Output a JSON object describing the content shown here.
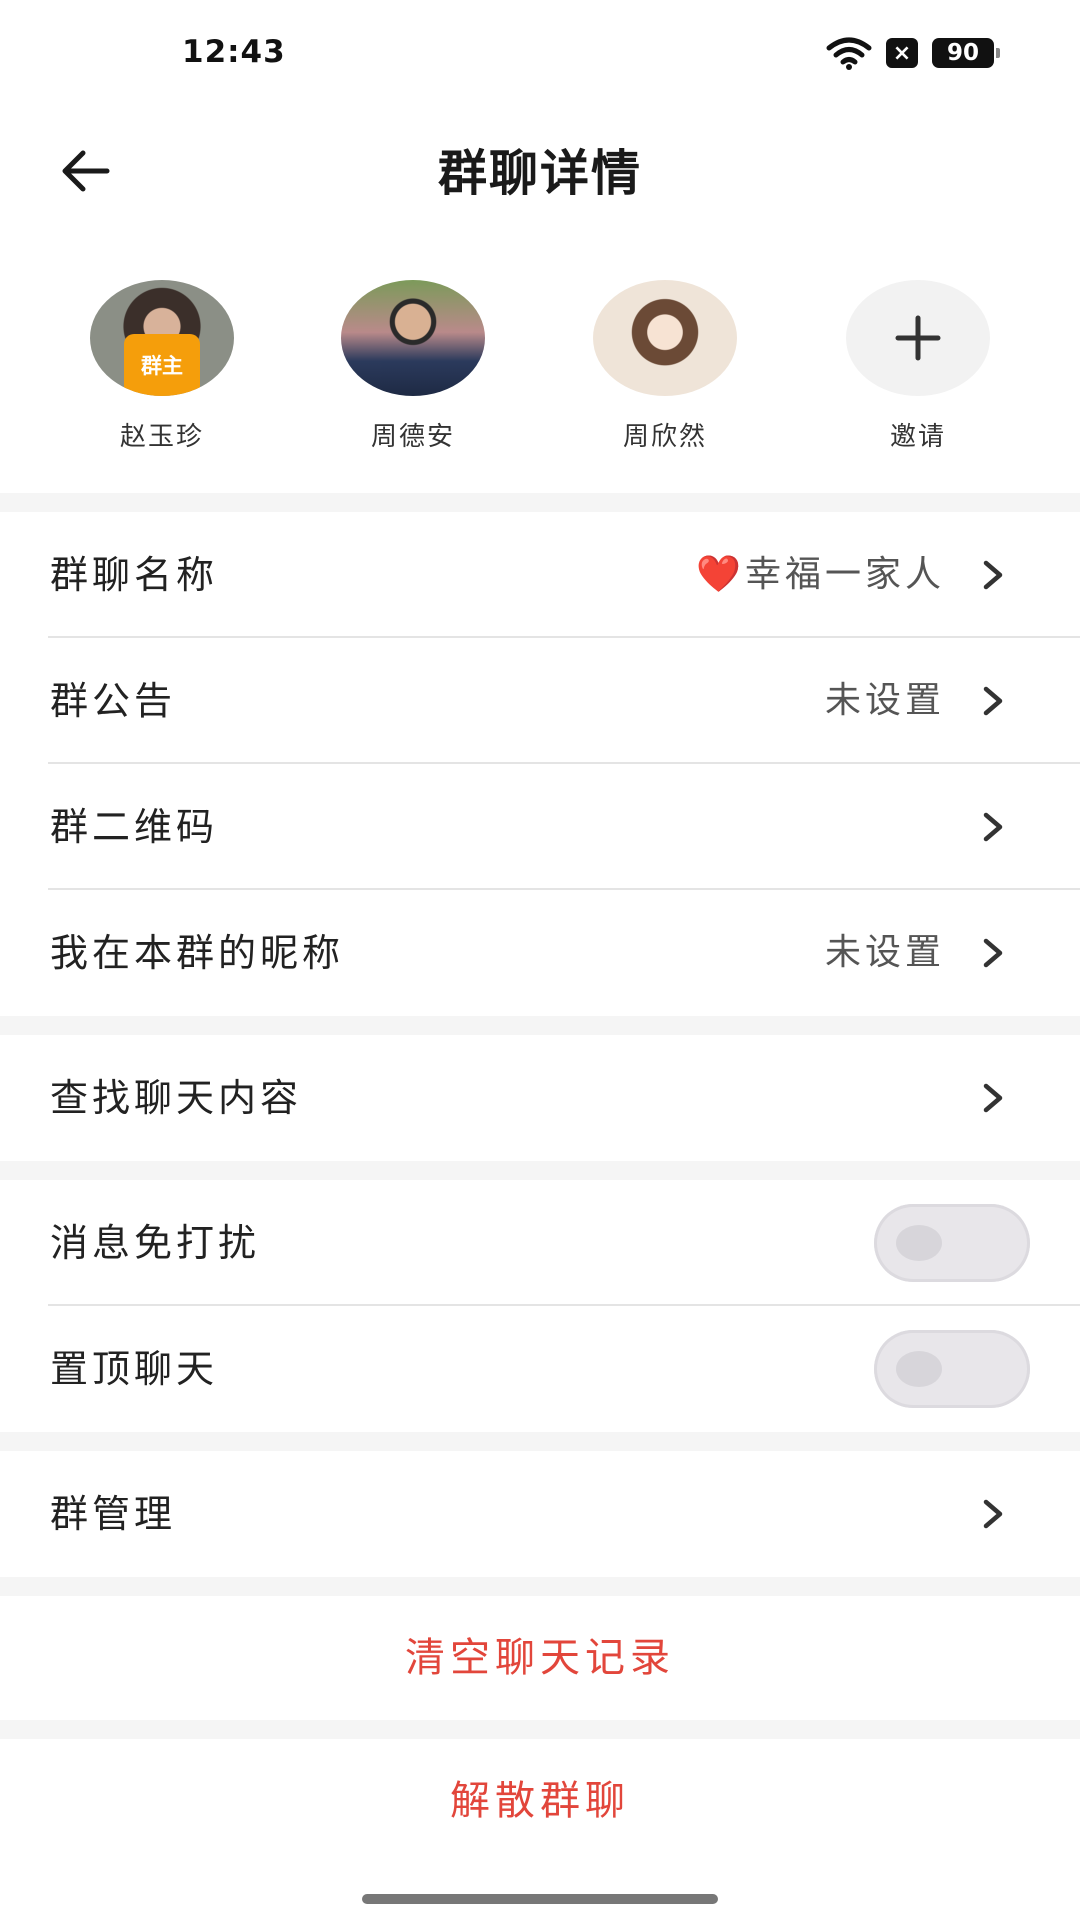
{
  "status": {
    "time": "12:43",
    "battery": "90",
    "notification_badge": "×"
  },
  "header": {
    "title": "群聊详情"
  },
  "members": [
    {
      "name": "赵玉珍",
      "badge": "群主",
      "avatar_colors": [
        "#3b2f2a",
        "#c99a82"
      ]
    },
    {
      "name": "周德安",
      "avatar_colors": [
        "#2b3a5c",
        "#c7a58a"
      ]
    },
    {
      "name": "周欣然",
      "avatar_colors": [
        "#6b4a36",
        "#f1d9c6"
      ]
    }
  ],
  "invite": {
    "label": "邀请",
    "icon": "plus-icon"
  },
  "settings": {
    "group_name": {
      "label": "群聊名称",
      "heart": "❤️",
      "value": "幸福一家人"
    },
    "announcement": {
      "label": "群公告",
      "value": "未设置"
    },
    "qr_code": {
      "label": "群二维码"
    },
    "my_nickname": {
      "label": "我在本群的昵称",
      "value": "未设置"
    },
    "search_history": {
      "label": "查找聊天内容"
    },
    "mute": {
      "label": "消息免打扰",
      "enabled": false
    },
    "pin": {
      "label": "置顶聊天",
      "enabled": false
    },
    "manage": {
      "label": "群管理"
    }
  },
  "actions": {
    "clear_history": "清空聊天记录",
    "dissolve": "解散群聊"
  },
  "colors": {
    "accent_red": "#e2463b",
    "owner_badge": "#f59e0b",
    "separator": "#f5f5f5"
  }
}
